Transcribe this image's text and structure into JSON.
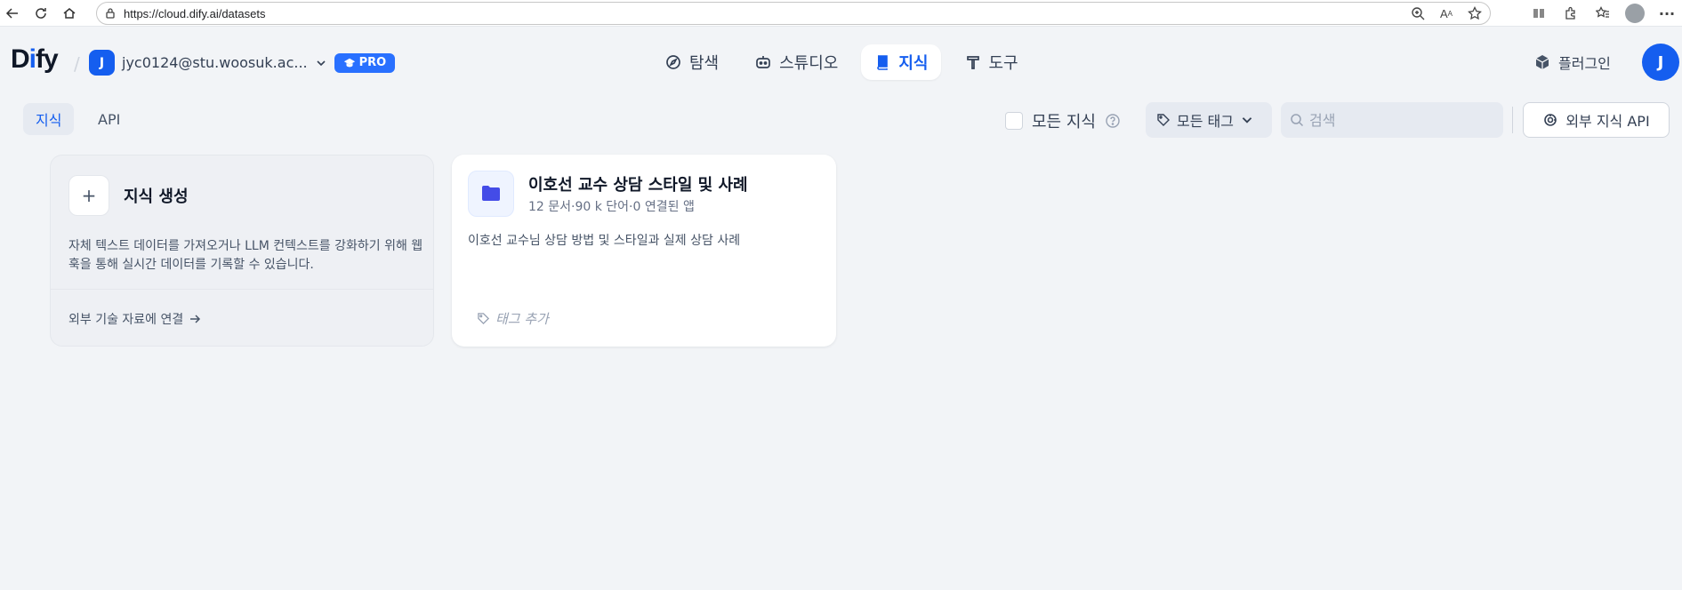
{
  "browser": {
    "url": "https://cloud.dify.ai/datasets"
  },
  "header": {
    "logo_text_start": "D",
    "logo_text_accent": "i",
    "logo_text_end": "fy",
    "workspace": {
      "avatar_letter": "J",
      "name": "jyc0124@stu.woosuk.ac...",
      "badge": "PRO"
    },
    "nav": [
      {
        "label": "탐색",
        "icon": "compass-icon"
      },
      {
        "label": "스튜디오",
        "icon": "robot-icon"
      },
      {
        "label": "지식",
        "icon": "book-icon",
        "active": true
      },
      {
        "label": "도구",
        "icon": "hammer-icon"
      }
    ],
    "plugins_label": "플러그인",
    "user_avatar_letter": "J"
  },
  "toolbar": {
    "tabs": [
      {
        "label": "지식",
        "active": true
      },
      {
        "label": "API",
        "active": false
      }
    ],
    "all_knowledge_label": "모든 지식",
    "tag_filter_label": "모든 태그",
    "search_placeholder": "검색",
    "external_api_label": "외부 지식 API"
  },
  "create_card": {
    "plus": "+",
    "title": "지식 생성",
    "description": "자체 텍스트 데이터를 가져오거나 LLM 컨텍스트를 강화하기 위해 웹훅을 통해 실시간 데이터를 기록할 수 있습니다.",
    "external_link": "외부 기술 자료에 연결"
  },
  "datasets": [
    {
      "title": "이호선 교수 상담 스타일 및 사례",
      "meta": "12 문서·90 k 단어·0 연결된 앱",
      "description": "이호선 교수님 상담 방법 및 스타일과 실제 상담 사례",
      "tag_placeholder": "태그 추가"
    }
  ],
  "colors": {
    "accent": "#155eef",
    "background": "#f2f4f7"
  }
}
